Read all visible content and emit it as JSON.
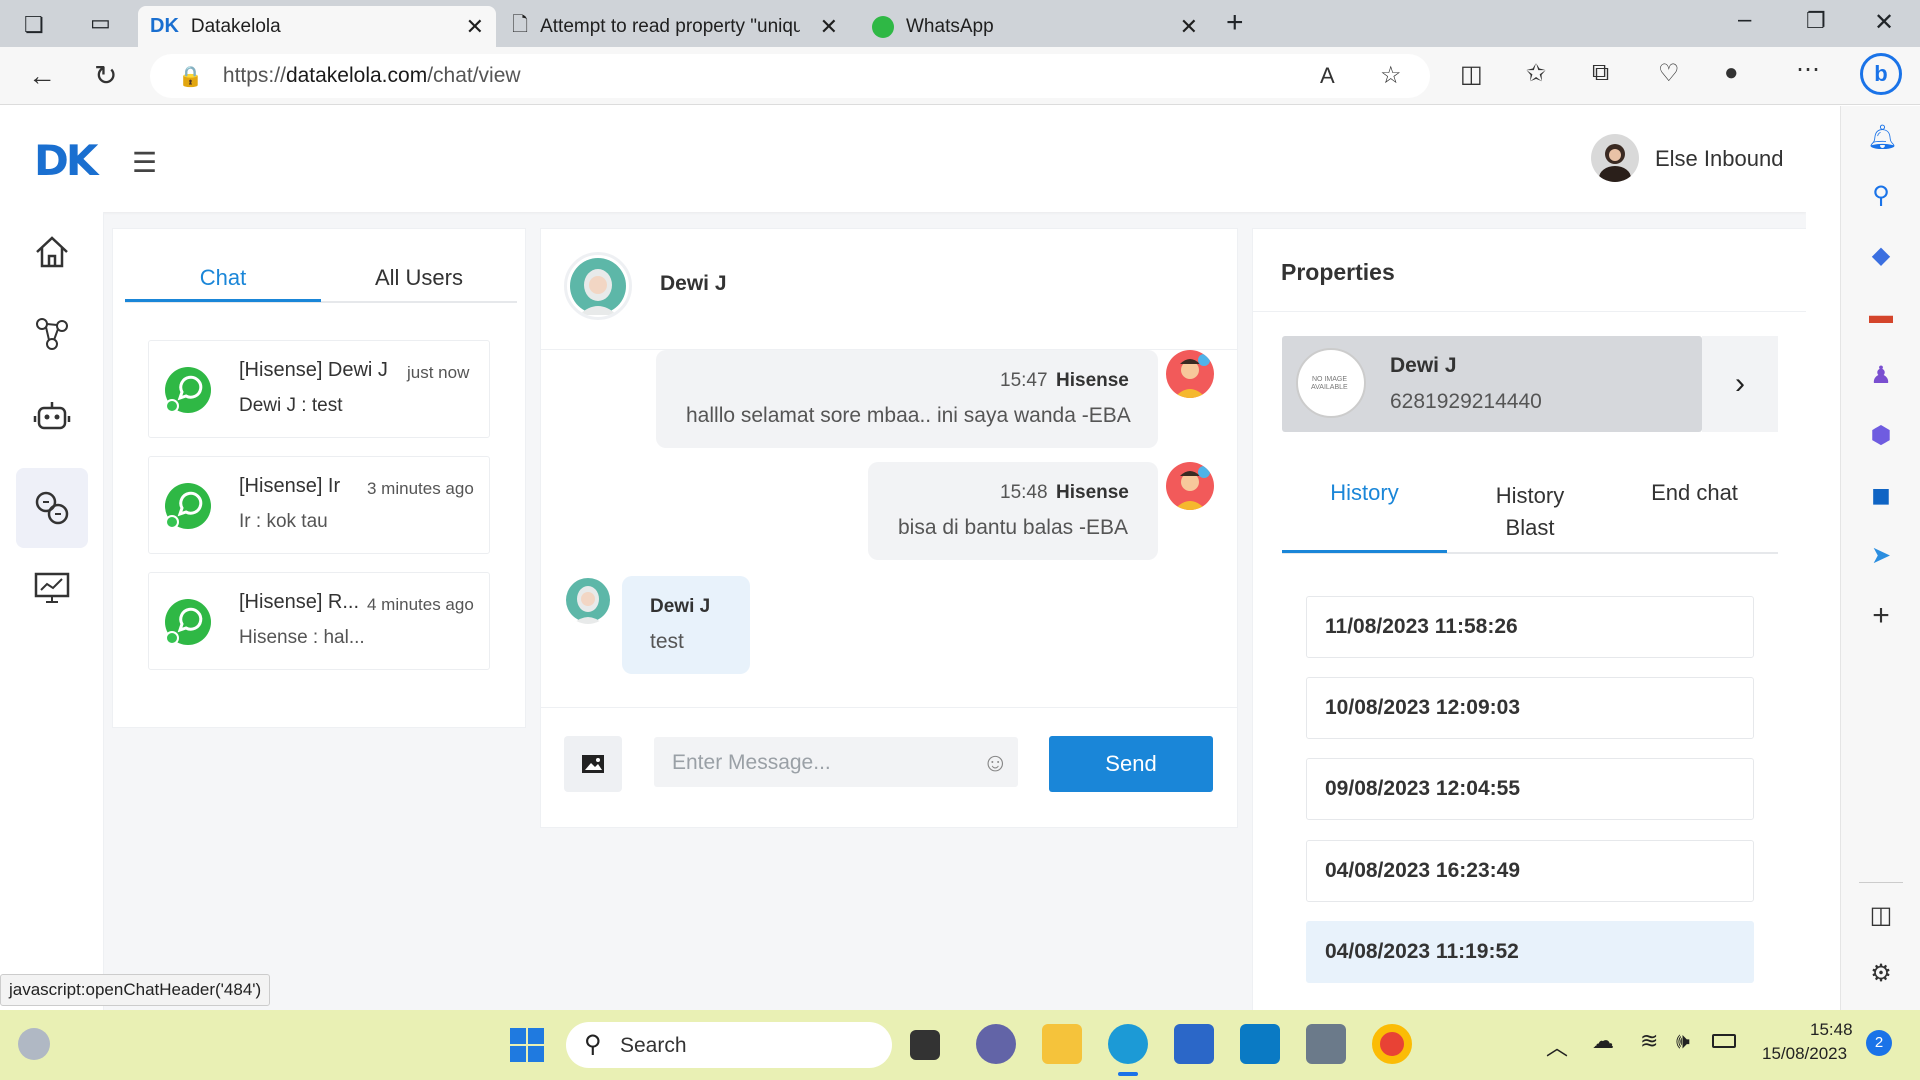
{
  "browser": {
    "tabs": [
      {
        "label": "Datakelola",
        "active": true
      },
      {
        "label": "Attempt to read property \"uniqu",
        "active": false
      },
      {
        "label": "WhatsApp",
        "active": false
      }
    ],
    "url_prefix": "https://",
    "url_host": "datakelola.com",
    "url_path": "/chat/view",
    "status_url": "javascript:openChatHeader('484')"
  },
  "app": {
    "logo_text": "DK",
    "user_name": "Else Inbound"
  },
  "sidebar": {
    "items": [
      {
        "icon": "home-icon",
        "active": false
      },
      {
        "icon": "network-icon",
        "active": false
      },
      {
        "icon": "robot-icon",
        "active": false
      },
      {
        "icon": "chat-support-icon",
        "active": true
      },
      {
        "icon": "monitor-chart-icon",
        "active": false
      }
    ]
  },
  "chat_list": {
    "tabs": [
      "Chat",
      "All Users"
    ],
    "active_tab": "Chat",
    "items": [
      {
        "name": "[Hisense] Dewi J",
        "time": "just now",
        "message": "Dewi J : test"
      },
      {
        "name": "[Hisense] Ir",
        "time": "3 minutes ago",
        "message": "Ir : kok tau"
      },
      {
        "name": "[Hisense] R...",
        "time": "4 minutes ago",
        "message": "Hisense : hal..."
      }
    ]
  },
  "conversation": {
    "contact_name": "Dewi J",
    "messages": [
      {
        "time": "15:47",
        "sender": "Hisense",
        "text": "halllo selamat sore mbaa.. ini saya wanda -EBA",
        "direction": "out"
      },
      {
        "time": "15:48",
        "sender": "Hisense",
        "text": "bisa di bantu balas -EBA",
        "direction": "out"
      },
      {
        "sender": "Dewi J",
        "text": "test",
        "direction": "in"
      }
    ],
    "input_placeholder": "Enter Message...",
    "send_label": "Send"
  },
  "properties": {
    "title": "Properties",
    "contact_name": "Dewi J",
    "contact_phone": "6281929214440",
    "no_image_line1": "NO IMAGE",
    "no_image_line2": "AVAILABLE",
    "tabs": [
      "History",
      "History Blast",
      "End chat"
    ],
    "active_tab": "History",
    "history": [
      "11/08/2023 11:58:26",
      "10/08/2023 12:09:03",
      "09/08/2023 12:04:55",
      "04/08/2023 16:23:49",
      "04/08/2023 11:19:52"
    ]
  },
  "taskbar": {
    "search_label": "Search",
    "time": "15:48",
    "date": "15/08/2023",
    "notification_count": "2"
  },
  "colors": {
    "accent": "#1a86d8",
    "send_button": "#1a86d8",
    "whatsapp_green": "#2fb845",
    "taskbar": "#e9f0b4"
  }
}
